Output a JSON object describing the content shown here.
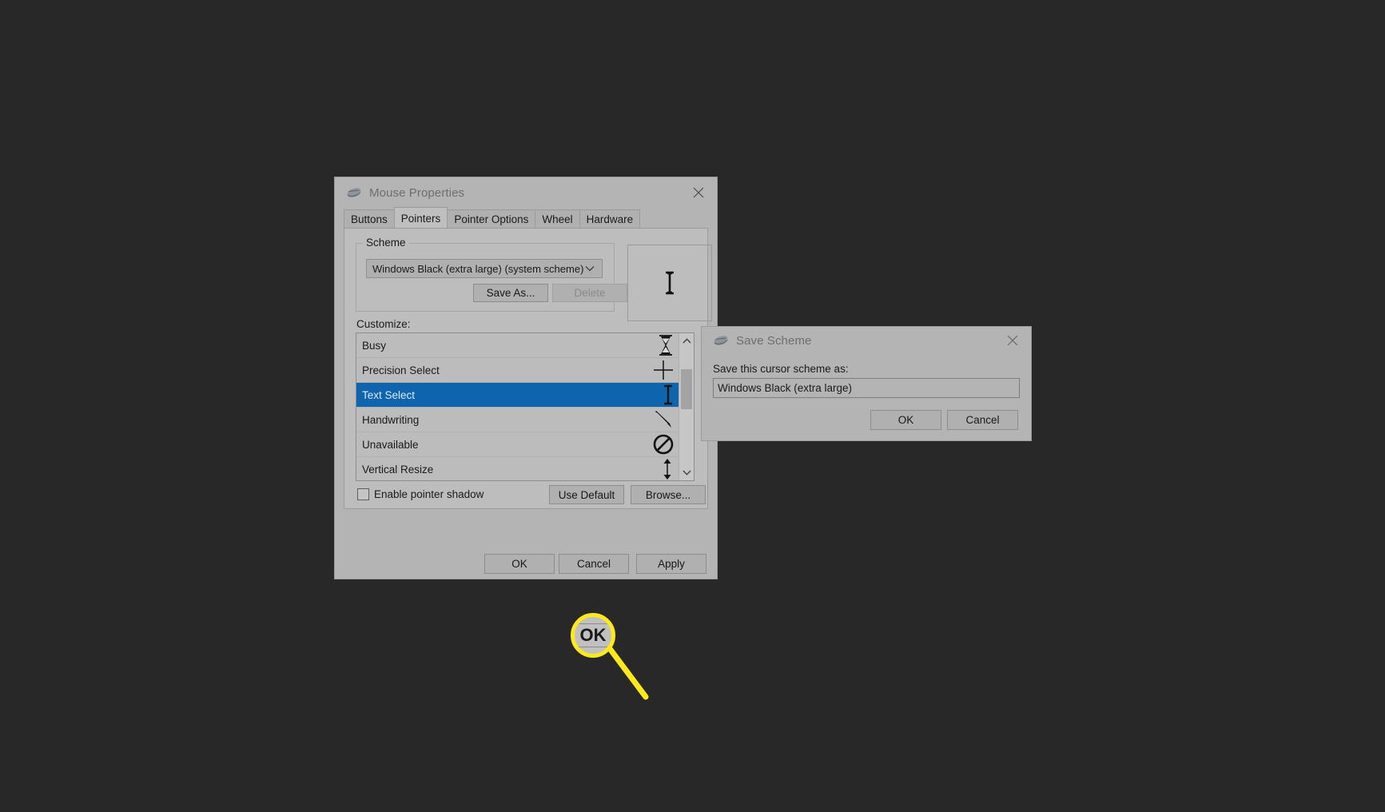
{
  "mouse_properties": {
    "title": "Mouse Properties",
    "title_icon": "mouse-icon",
    "close_icon": "close-icon",
    "tabs": [
      {
        "label": "Buttons",
        "active": false
      },
      {
        "label": "Pointers",
        "active": true
      },
      {
        "label": "Pointer Options",
        "active": false
      },
      {
        "label": "Wheel",
        "active": false
      },
      {
        "label": "Hardware",
        "active": false
      }
    ],
    "scheme": {
      "legend": "Scheme",
      "selected": "Windows Black (extra large) (system scheme)",
      "save_as_label": "Save As...",
      "delete_label": "Delete",
      "delete_disabled": true,
      "preview_cursor": "text-select-ibeam"
    },
    "customize": {
      "label": "Customize:",
      "items": [
        {
          "label": "Busy",
          "icon": "hourglass-icon",
          "selected": false
        },
        {
          "label": "Precision Select",
          "icon": "crosshair-icon",
          "selected": false
        },
        {
          "label": "Text Select",
          "icon": "ibeam-icon",
          "selected": true
        },
        {
          "label": "Handwriting",
          "icon": "pen-icon",
          "selected": false
        },
        {
          "label": "Unavailable",
          "icon": "no-entry-icon",
          "selected": false
        },
        {
          "label": "Vertical Resize",
          "icon": "vertical-resize-icon",
          "selected": false
        }
      ]
    },
    "pointer_shadow": {
      "label": "Enable pointer shadow",
      "checked": false
    },
    "use_default_label": "Use Default",
    "browse_label": "Browse...",
    "footer": {
      "ok": "OK",
      "cancel": "Cancel",
      "apply": "Apply"
    }
  },
  "save_scheme": {
    "title": "Save Scheme",
    "title_icon": "mouse-icon",
    "close_icon": "close-icon",
    "prompt": "Save this cursor scheme as:",
    "input_value": "Windows Black (extra large)",
    "ok": "OK",
    "cancel": "Cancel"
  },
  "callout": {
    "badge_label": "OK",
    "highlight_color": "#ffe81c"
  },
  "colors": {
    "background": "#282828",
    "window_face": "#b4b4b4",
    "selection": "#0f65ad",
    "accent": "#ffe81c"
  }
}
